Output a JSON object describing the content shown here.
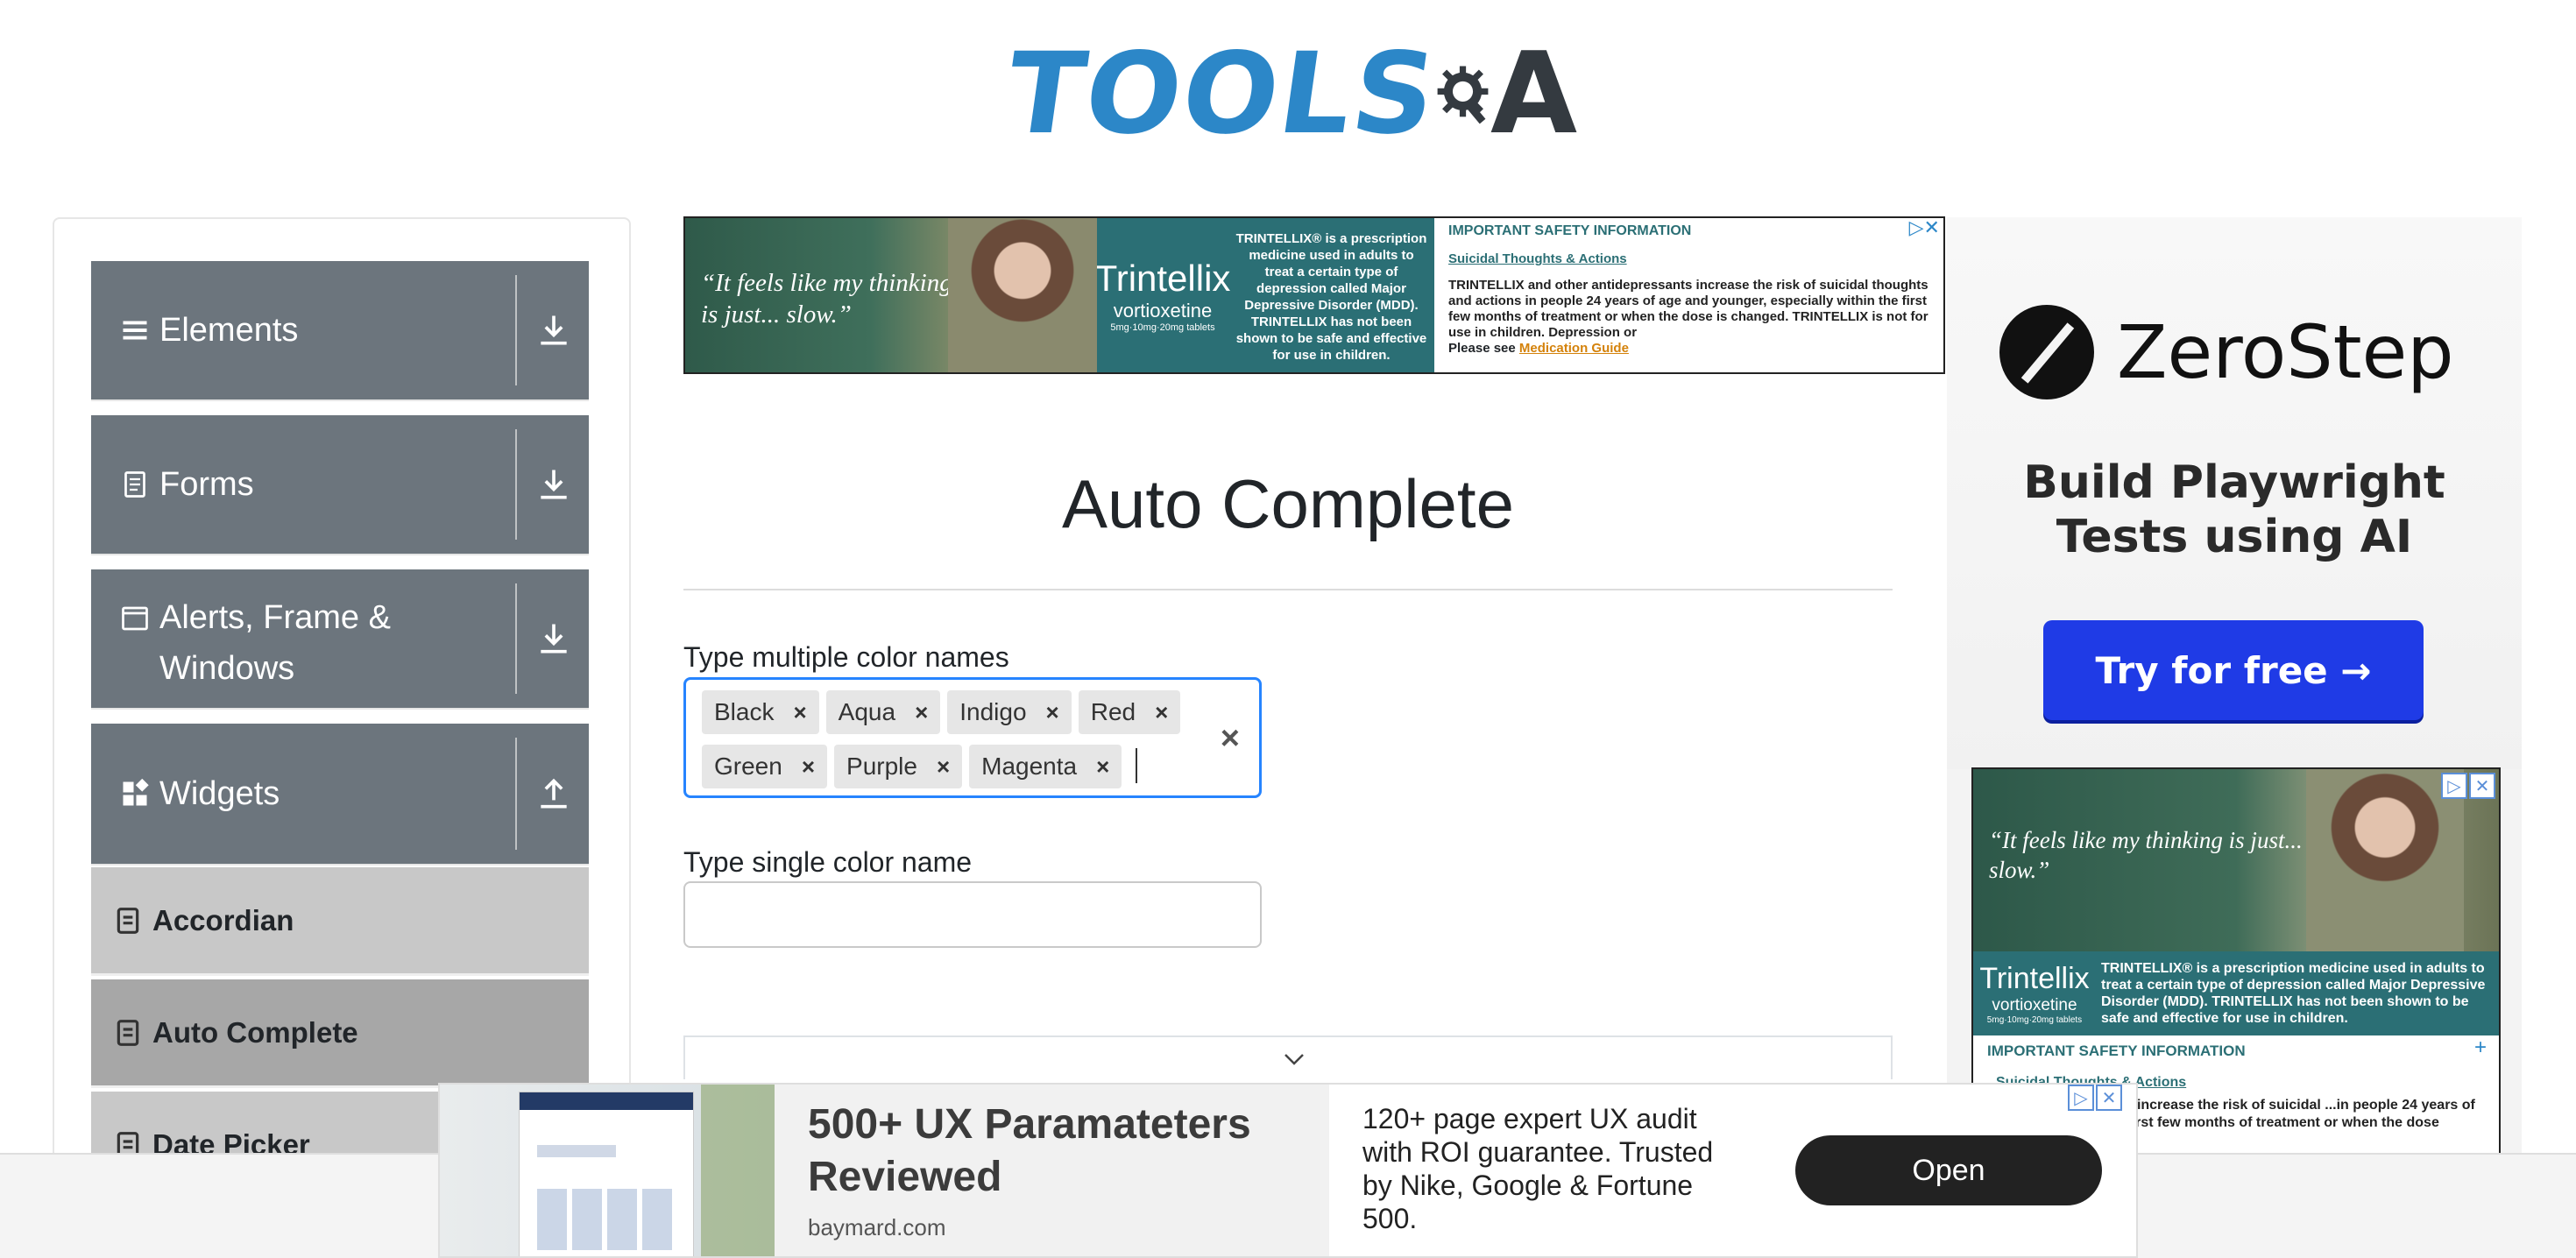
{
  "logo": {
    "text_main": "TOOLS",
    "text_end": "A"
  },
  "sidebar": {
    "groups": [
      {
        "label": "Elements",
        "icon": "list-icon",
        "arrow": "download-icon"
      },
      {
        "label": "Forms",
        "icon": "document-icon",
        "arrow": "download-icon"
      },
      {
        "label_line1": "Alerts, Frame &",
        "label_line2": "Windows",
        "icon": "window-icon",
        "arrow": "download-icon"
      },
      {
        "label": "Widgets",
        "icon": "widgets-icon",
        "arrow": "upload-icon"
      }
    ],
    "items": [
      {
        "label": "Accordian",
        "active": false
      },
      {
        "label": "Auto Complete",
        "active": true
      },
      {
        "label": "Date Picker",
        "active": false
      }
    ]
  },
  "ad_top": {
    "quote": "“It feels like my thinking is just... slow.”",
    "brand": "Trintellix",
    "brand_sub": "vortioxetine",
    "brand_dose": "5mg·10mg·20mg tablets",
    "brand_text": "TRINTELLIX® is a prescription medicine used in adults to treat a certain type of depression called Major Depressive Disorder (MDD). TRINTELLIX has not been shown to be safe and effective for use in children.",
    "isi_title": "IMPORTANT SAFETY INFORMATION",
    "isi_sub": "Suicidal Thoughts & Actions",
    "isi_body": "TRINTELLIX and other antidepressants increase the risk of suicidal thoughts and actions in people 24 years of age and younger, especially within the first few months of treatment or when the dose is changed. TRINTELLIX is not for use in children. Depression or",
    "isi_see": "Please see",
    "isi_link": "Medication Guide"
  },
  "main": {
    "title": "Auto Complete",
    "multi_label": "Type multiple color names",
    "chips": [
      "Black",
      "Aqua",
      "Indigo",
      "Red",
      "Green",
      "Purple",
      "Magenta"
    ],
    "chip_remove": "×",
    "clear_all": "×",
    "single_label": "Type single color name",
    "single_value": ""
  },
  "ad_right": {
    "brand": "ZeroStep",
    "tagline_1": "Build Playwright",
    "tagline_2": "Tests using AI",
    "cta": "Try for free →",
    "quote": "“It feels like my thinking is just... slow.”",
    "brand2": "Trintellix",
    "brand2_sub": "vortioxetine",
    "brand2_dose": "5mg·10mg·20mg tablets",
    "brand2_text": "TRINTELLIX® is a prescription medicine used in adults to treat a certain type of depression called Major Depressive Disorder (MDD). TRINTELLIX has not been shown to be safe and effective for use in children.",
    "isi_title": "IMPORTANT SAFETY INFORMATION",
    "isi_plus": "+",
    "isi_sub": "Suicidal Thoughts & Actions",
    "isi_body": "...or antidepressants increase the risk of suicidal ...in people 24 years of age and younger, ...first few months of treatment or when the dose"
  },
  "bottom_ad": {
    "headline": "500+ UX Paramateters Reviewed",
    "domain": "baymard.com",
    "copy": "120+ page expert UX audit with ROI guarantee. Trusted by Nike, Google & Fortune 500.",
    "cta": "Open"
  },
  "colors": {
    "accent": "#2684ff",
    "sidebar_group": "#6c757d",
    "sidebar_item": "#c8c8c8",
    "logo_blue": "#2c87c8"
  }
}
